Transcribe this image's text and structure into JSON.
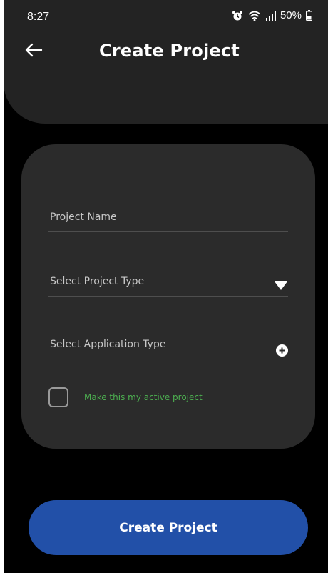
{
  "status_bar": {
    "time": "8:27",
    "battery_text": "50%",
    "icons": [
      "alarm-icon",
      "wifi-icon",
      "signal-icon",
      "battery-icon"
    ]
  },
  "header": {
    "title": "Create Project",
    "back_icon": "arrow-left-icon"
  },
  "form": {
    "project_name_placeholder": "Project Name",
    "project_type_placeholder": "Select Project Type",
    "project_type_icon": "triangle-down-icon",
    "application_type_placeholder": "Select Application Type",
    "application_type_icon": "plus-circle-icon",
    "active_project_label": "Make this my active project",
    "active_project_checked": false
  },
  "actions": {
    "create_label": "Create Project"
  },
  "colors": {
    "background": "#000000",
    "card": "#2b2b2b",
    "header": "#232323",
    "accent_green": "#4caf50",
    "primary_button": "#2250a8"
  }
}
